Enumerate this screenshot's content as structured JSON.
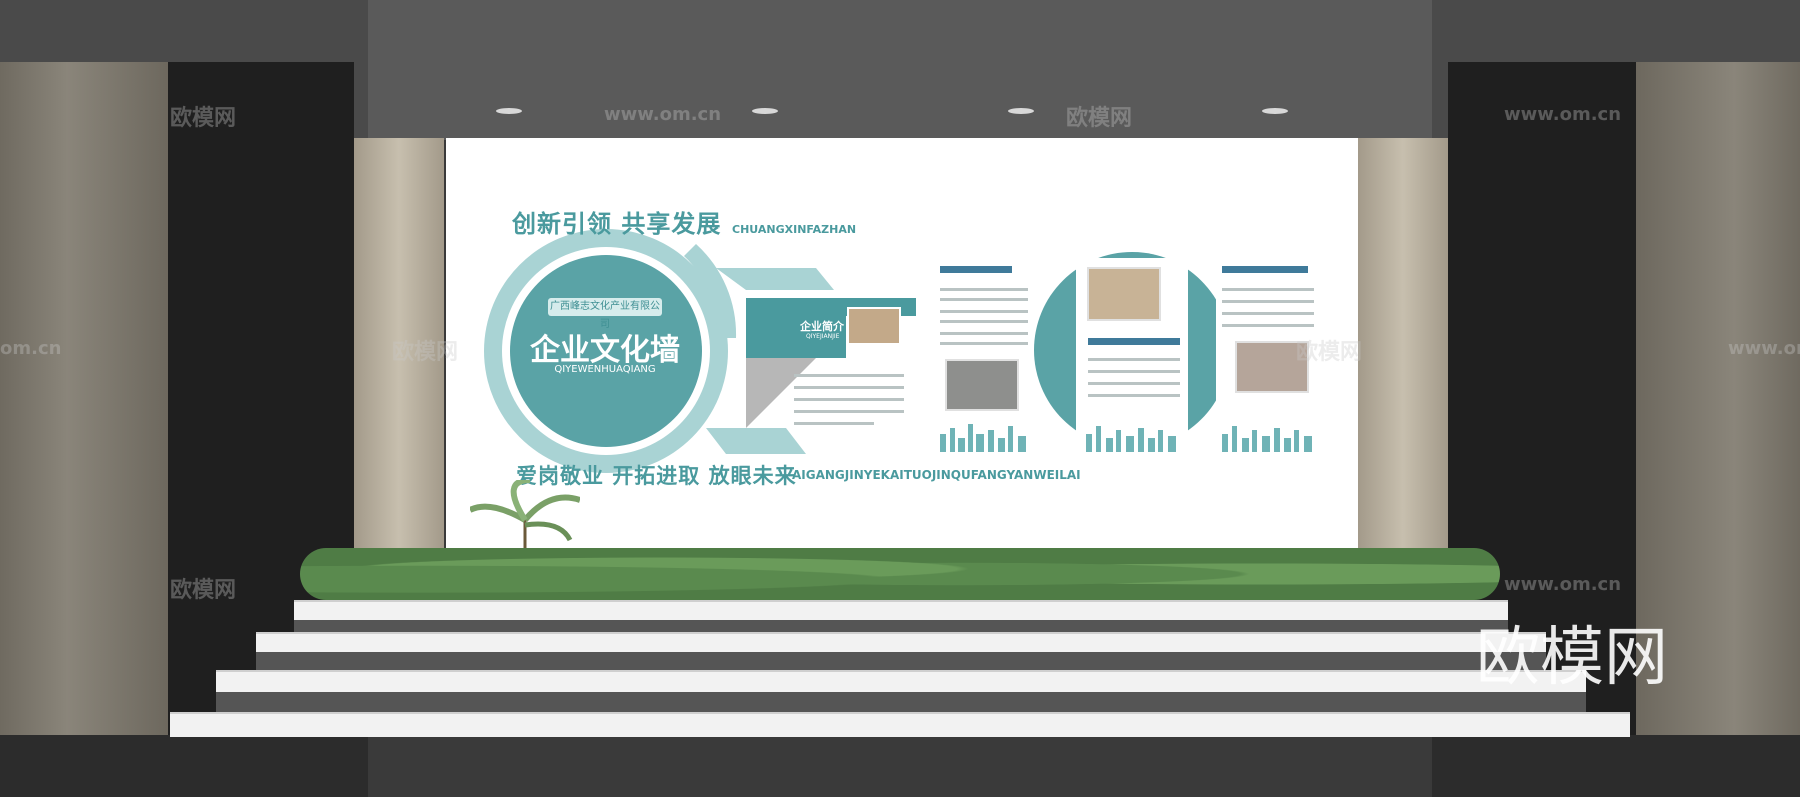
{
  "watermarks": {
    "site": "www.om.cn",
    "brand": "欧模网",
    "site_short": "om.cn"
  },
  "board": {
    "slogan_top": "创新引领 共享发展",
    "slogan_top_pinyin": "CHUANGXINFAZHAN",
    "slogan_bottom": "爱岗敬业 开拓进取 放眼未来",
    "slogan_bottom_pinyin": "AIGANGJINYEKAITUOJINQUFANGYANWEILAI",
    "company_name": "广西峰志文化产业有限公司",
    "main_title": "企业文化墙",
    "main_title_pinyin": "QIYEWENHUAQIANG",
    "intro_label": "企业简介",
    "intro_sub": "QIYEJIANJIE"
  },
  "colors": {
    "accent": "#4a9a9e",
    "accent_dark": "#3f8f93",
    "accent_light": "#a9d3d4"
  }
}
